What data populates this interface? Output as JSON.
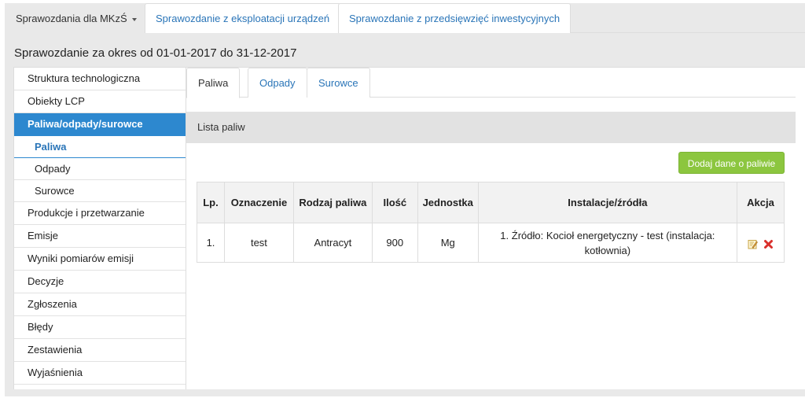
{
  "top_tabs": [
    {
      "label": "Sprawozdania dla MKzŚ"
    },
    {
      "label": "Sprawozdanie z eksploatacji urządzeń"
    },
    {
      "label": "Sprawozdanie z przedsięwzięć inwestycyjnych"
    }
  ],
  "period_title": "Sprawozdanie za okres od 01-01-2017 do 31-12-2017",
  "sidebar": {
    "items": [
      {
        "label": "Struktura technologiczna"
      },
      {
        "label": "Obiekty LCP"
      },
      {
        "label": "Paliwa/odpady/surowce"
      },
      {
        "label": "Paliwa"
      },
      {
        "label": "Odpady"
      },
      {
        "label": "Surowce"
      },
      {
        "label": "Produkcje i przetwarzanie"
      },
      {
        "label": "Emisje"
      },
      {
        "label": "Wyniki pomiarów emisji"
      },
      {
        "label": "Decyzje"
      },
      {
        "label": "Zgłoszenia"
      },
      {
        "label": "Błędy"
      },
      {
        "label": "Zestawienia"
      },
      {
        "label": "Wyjaśnienia"
      }
    ]
  },
  "inner_tabs": [
    {
      "label": "Paliwa"
    },
    {
      "label": "Odpady"
    },
    {
      "label": "Surowce"
    }
  ],
  "list_title": "Lista paliw",
  "add_button": "Dodaj dane o paliwie",
  "table": {
    "headers": [
      "Lp.",
      "Oznaczenie",
      "Rodzaj paliwa",
      "Ilość",
      "Jednostka",
      "Instalacje/źródła",
      "Akcja"
    ],
    "rows": [
      {
        "lp": "1.",
        "oznaczenie": "test",
        "rodzaj": "Antracyt",
        "ilosc": "900",
        "jednostka": "Mg",
        "instalacje": "1. Źródło: Kocioł energetyczny - test (instalacja: kotłownia)"
      }
    ]
  },
  "icons": {
    "edit": "edit-icon",
    "delete": "delete-icon"
  },
  "colors": {
    "accent": "#2d88cf",
    "link": "#2a75b8",
    "add_button": "#8cc63f",
    "delete": "#d9302c"
  }
}
